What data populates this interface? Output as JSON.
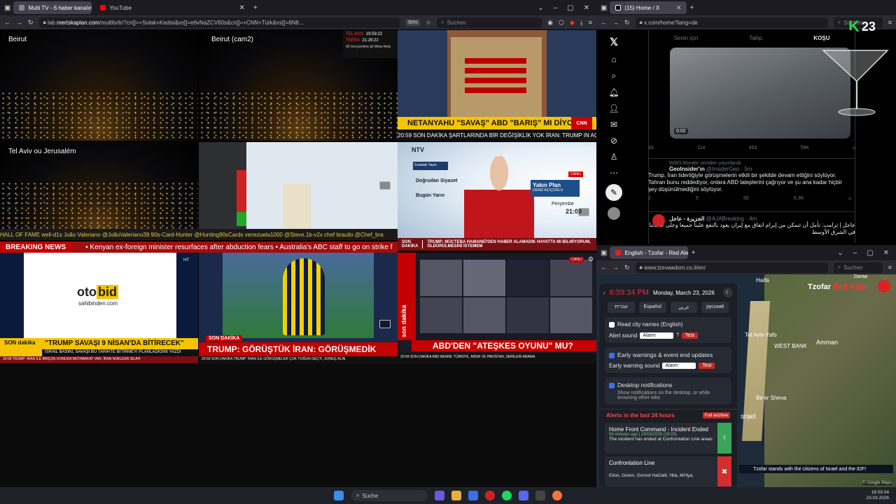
{
  "left_browser": {
    "tabs": [
      {
        "label": "Multi TV - 6 haber kanalını"
      },
      {
        "label": "YouTube"
      }
    ],
    "url_prefix": "lab.",
    "url_domain": "mertskaplan.com",
    "url_rest": "/multitv/tr/?cn[]=+Solak+Kedisi&vs[]=e6vNaZCV60s&cn[]=+CNN+Türk&vs[]=6N8...",
    "zoom": "90%",
    "search_placeholder": "Suchen"
  },
  "grid": {
    "cam1_label": "Beirut",
    "cam2_label": "Beirut (cam2)",
    "cam3_label": "Tel Aviv ou Jerusalém",
    "clock_city1": "TEL AVIV",
    "clock_time1": "19:59:22",
    "clock_city2": "TEERA",
    "clock_time2": "21:29:22",
    "clock_caption": "05 Gerçümlere pil Meta-Neta",
    "cnn_headline": "NETANYAHU \"SAVAŞ\" ABD \"BARIŞ\" MI DİYOR?",
    "cnn_ticker": "20:59 SON DAKİKA  ŞARTLARINDA BİR DEĞİŞİKLİK YOK   İRAN: TRUMP IN AÇ",
    "chat_ticker": "HALL OF FAME  well-d1s   João Valeriano @JoãoValeriano39   90s-Card-Hunter @Hunting90sCards   venezuela1000 @Steve.1b-v2x   chef brauilo @Chef_bra",
    "breaking_label": "BREAKING NEWS",
    "breaking_text": "•  Kenyan ex-foreign minister resurfaces after abduction fears   •  Australia's ABC staff to go on strike f",
    "ntv_show": "Yakın Plan",
    "ntv_sub": "DENİZ KILIÇOĞLU",
    "ntv_day": "Perşembe",
    "ntv_time": "21:00",
    "ntv_sched_1": "Doğrudan Siyaset",
    "ntv_sched_2": "Bugün Yarın",
    "ntv_live": "CANLI",
    "ntv_son": "SON DAKİKA",
    "ntv_ticker": "TRUMP: MÜCTEBA HAMANEİ'DEN HABER ALAMADIK HAYATTA MI BİLMİYORUM, ÖLDÜRÜLMESİNİ İSTEMEM",
    "oto_brand1": "oto",
    "oto_brand2": "bid",
    "oto_sub": "sahibinden.com",
    "ht_head": "\"TRUMP SAVAŞI 9 NİSAN'DA BİTİRECEK\"",
    "ht_sub": "İSRAİL BASINI, SAVAŞI BU TARİHTE BİTİRMEYİ PLANLADIĞINI YAZDI",
    "ht_son": "SON dakika",
    "ht_ticker": "20:59  TRUMP: İRAN İLE BİRÇOK KONUDA MUTABAKAT VAR, İRAN NÜKLEER SİLAH",
    "fb_son": "SON DAKİKA",
    "fb_head": "TRUMP: GÖRÜŞTÜK İRAN: GÖRÜŞMEDİK",
    "fb_ticker": "20:59  SON DAKİKA  TRUMP: İRAN İLE GÖRÜŞMELER ÇOK YOĞUN GEÇTİ, SONUÇ ALIN",
    "a_head": "ABD'DEN \"ATEŞKES OYUNU\" MU?",
    "a_son": "son dakika",
    "a_ticker": "20:59  SON DAKİKA  ABD BASINI: TÜRKİYE, MISIR VE PAKİSTAN, SERİLERİ ARAMA",
    "a_live": "CANLI"
  },
  "x_browser": {
    "tab": "(15) Home / X",
    "url": "x.com/home?lang=de",
    "search_placeholder": "Suchen",
    "logo_text": "23",
    "tabs": [
      "Senin için",
      "Takip",
      "KOŞU"
    ],
    "video_time": "0:02",
    "stats1": [
      "33",
      "114",
      "453",
      "59K"
    ],
    "repost_note": "WW3 Monitör yeniden yayınlandı",
    "tweet2_name": "GeoInsider'ın",
    "tweet2_handle": "@InsiderGeo · 5m",
    "tweet2_text": "Trump, İran liderliğiyle görüşmelerin etkili bir şekilde devam ettiğini söylüyor. Tahran bunu reddediyor, onlara ABD taleplerini çağrıyor ve şu ana kadar hiçbir şey düşünülmediğini söylüyor.",
    "stats2": [
      "2",
      "5",
      "50",
      "6.3K"
    ],
    "tweet3_name": "الجزيرة - عاجل",
    "tweet3_handle": "@AJABreaking · 4m",
    "tweet3_text": "عاجل | ترامب: تأمل أن تتمكن من إبرام اتفاق مع إيران يعود بالنفع علينا جميعا وعلى حلفائنا في الشرق الأوسط"
  },
  "tz_browser": {
    "tab": "English - Tzofar - Red Alert",
    "url": "www.tzevaadom.co.il/en/",
    "search_placeholder": "Suchen",
    "time": "6:59:34 PM",
    "date": "Monday, March 23, 2026",
    "langs": [
      "עברית",
      "Español",
      "عربي",
      "русский"
    ],
    "read_city": "Read city names (English)",
    "alert_sound_label": "Alert sound",
    "alert_sound_value": "Alarm",
    "test": "Test",
    "early_title": "Early warnings & event end updates",
    "early_sound_label": "Early warning sound",
    "early_sound_value": "Alarm",
    "desktop_title": "Desktop notifications",
    "desktop_sub": "Show notifications on the desktop, or while browsing other tabs",
    "alerts_title": "Alerts in the last 24 hours",
    "full_archive": "Full archive",
    "alert1_title": "Home Front Command - Incident Ended",
    "alert1_time": "56 minutes ago | 23/03/2026 (18:03)",
    "alert1_text": "The incident has ended at Confrontation Line areas",
    "alert2_title": "Confrontation Line",
    "alert2_text": "Eilon, Goren, Gornot HaGalil, Hila, Mi'ilya,",
    "map_labels": [
      "Haifa",
      "Tel Aviv-Yafo",
      "Amman",
      "WEST BANK",
      "Be'er Sheva",
      "srael",
      "Daraa",
      "Tzofar",
      "Red Alert"
    ],
    "banner": "Tzofar stands with the citizens of Israel and the IDF!",
    "google": "© Google Maps"
  },
  "taskbar": {
    "search": "Suche",
    "time": "18:59:34",
    "date": "23.03.2026"
  }
}
